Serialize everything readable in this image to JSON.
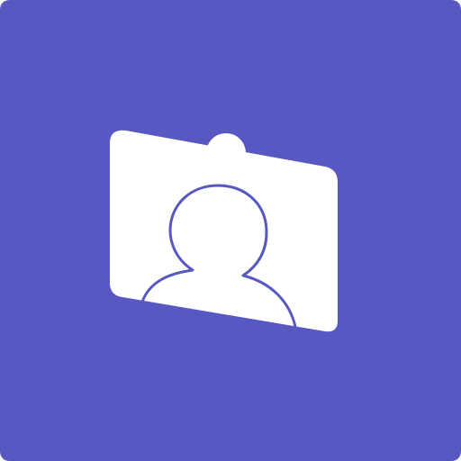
{
  "icon": {
    "name": "webcam-profile-icon",
    "colors": {
      "background": "#5858C2",
      "card": "#FFFFFF",
      "outline": "#5858C2"
    }
  }
}
